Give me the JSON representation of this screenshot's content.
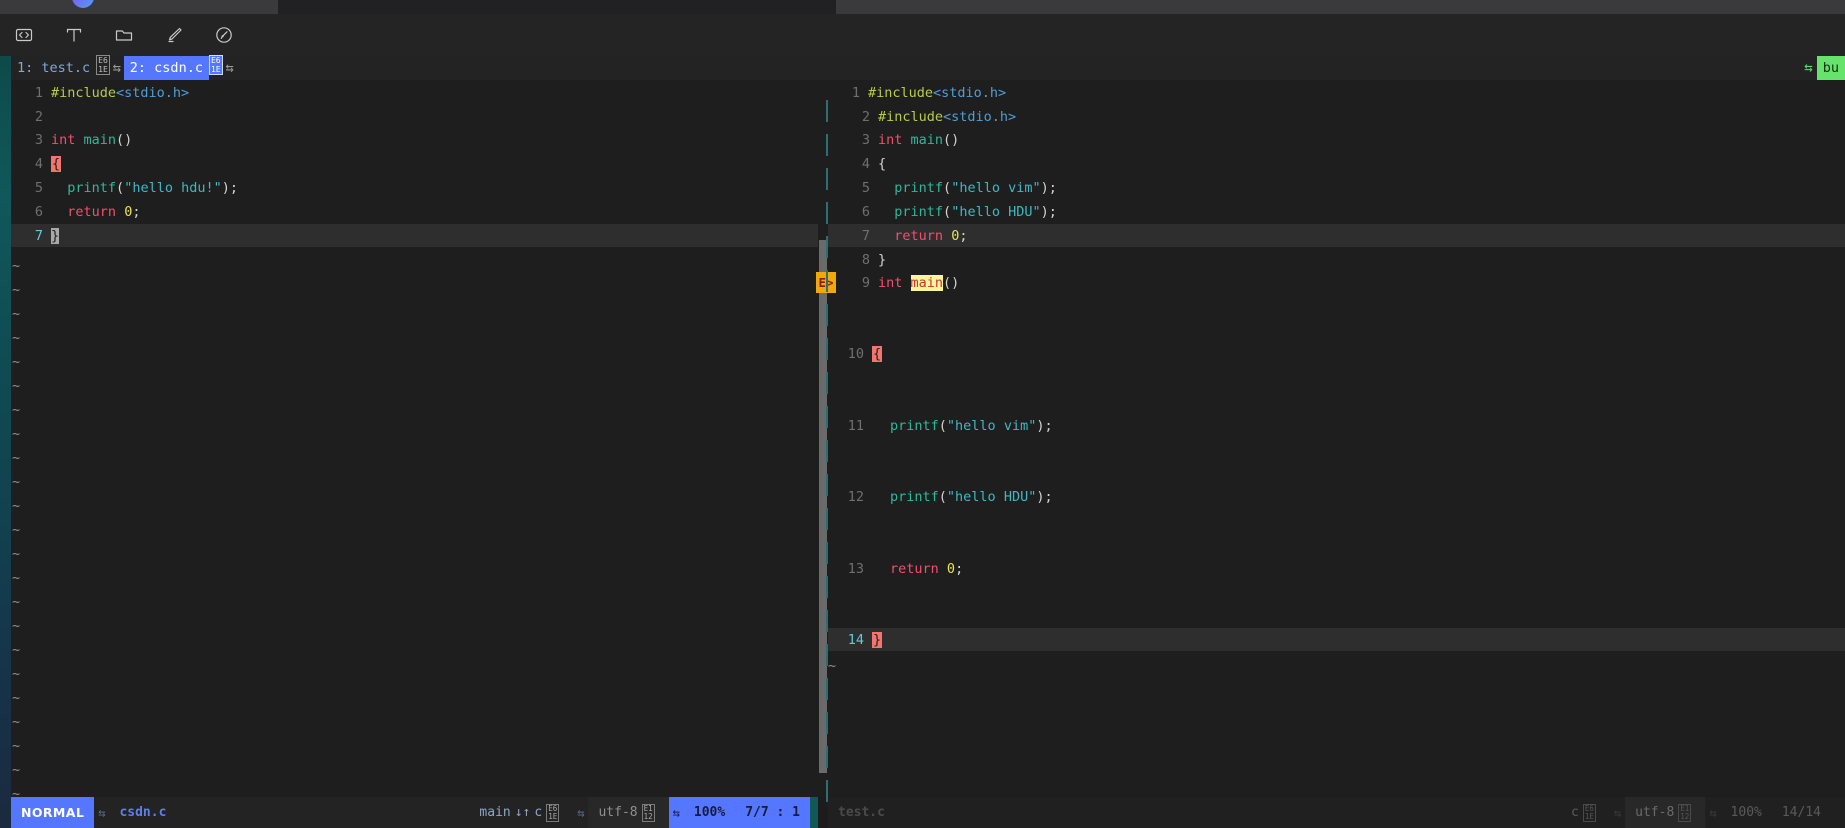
{
  "window": {
    "os_tabs": [
      "",
      "",
      ""
    ],
    "logo_icon": "app-logo"
  },
  "toolbar": {
    "icons": [
      {
        "name": "code-brackets-icon",
        "label": "<>"
      },
      {
        "name": "text-tool-icon",
        "label": "T"
      },
      {
        "name": "folder-icon",
        "label": "folder"
      },
      {
        "name": "pencil-edit-icon",
        "label": "edit"
      },
      {
        "name": "compass-dashboard-icon",
        "label": "compass"
      }
    ]
  },
  "tabline": {
    "tabs": [
      {
        "label": "1: test.c",
        "selected": false,
        "glyph_top": "E6",
        "glyph_bottom": "1E"
      },
      {
        "label": "2: csdn.c",
        "selected": true,
        "glyph_top": "E6",
        "glyph_bottom": "1E"
      }
    ],
    "separator": "⇆",
    "right_label": "bu",
    "right_arrow": "⇆"
  },
  "left_editor": {
    "filename": "test.c",
    "lines": [
      {
        "num": "1",
        "tokens": [
          {
            "t": "#include",
            "c": "s-pre"
          },
          {
            "t": "<stdio.h>",
            "c": "s-inc"
          }
        ]
      },
      {
        "num": "2",
        "tokens": []
      },
      {
        "num": "3",
        "tokens": [
          {
            "t": "int",
            "c": "s-kw"
          },
          {
            "t": " ",
            "c": "s-punc"
          },
          {
            "t": "main",
            "c": "s-fn"
          },
          {
            "t": "()",
            "c": "s-punc"
          }
        ]
      },
      {
        "num": "4",
        "tokens": [
          {
            "t": "{",
            "c": "err-brace"
          }
        ]
      },
      {
        "num": "5",
        "tokens": [
          {
            "t": "  ",
            "c": "s-punc"
          },
          {
            "t": "printf",
            "c": "s-fn"
          },
          {
            "t": "(",
            "c": "s-punc"
          },
          {
            "t": "\"hello hdu!\"",
            "c": "s-str"
          },
          {
            "t": ");",
            "c": "s-punc"
          }
        ]
      },
      {
        "num": "6",
        "tokens": [
          {
            "t": "  ",
            "c": "s-punc"
          },
          {
            "t": "return",
            "c": "s-kw"
          },
          {
            "t": " ",
            "c": "s-punc"
          },
          {
            "t": "0",
            "c": "s-num"
          },
          {
            "t": ";",
            "c": "s-punc"
          }
        ]
      },
      {
        "num": "7",
        "tokens": [
          {
            "t": "}",
            "c": "cursor"
          }
        ],
        "current": true
      }
    ],
    "tilde_count": 23,
    "tilde": "~"
  },
  "right_editor": {
    "filename": "test.c",
    "lines": [
      {
        "num": "1",
        "tokens": [
          {
            "t": "#include",
            "c": "s-pre"
          },
          {
            "t": "<stdio.h>",
            "c": "s-inc"
          }
        ]
      },
      {
        "num": "2",
        "tokens": [
          {
            "t": "#include",
            "c": "s-pre"
          },
          {
            "t": "<stdio.h>",
            "c": "s-inc"
          }
        ]
      },
      {
        "num": "3",
        "tokens": [
          {
            "t": "int",
            "c": "s-kw"
          },
          {
            "t": " ",
            "c": "s-punc"
          },
          {
            "t": "main",
            "c": "s-fn"
          },
          {
            "t": "()",
            "c": "s-punc"
          }
        ]
      },
      {
        "num": "4",
        "tokens": [
          {
            "t": "{",
            "c": "s-brace"
          }
        ]
      },
      {
        "num": "5",
        "tokens": [
          {
            "t": "  ",
            "c": "s-punc"
          },
          {
            "t": "printf",
            "c": "s-fn"
          },
          {
            "t": "(",
            "c": "s-punc"
          },
          {
            "t": "\"hello vim\"",
            "c": "s-str"
          },
          {
            "t": ");",
            "c": "s-punc"
          }
        ]
      },
      {
        "num": "6",
        "tokens": [
          {
            "t": "  ",
            "c": "s-punc"
          },
          {
            "t": "printf",
            "c": "s-fn"
          },
          {
            "t": "(",
            "c": "s-punc"
          },
          {
            "t": "\"hello HDU\"",
            "c": "s-str"
          },
          {
            "t": ");",
            "c": "s-punc"
          }
        ]
      },
      {
        "num": "7",
        "tokens": [
          {
            "t": "  ",
            "c": "s-punc"
          },
          {
            "t": "return",
            "c": "s-kw"
          },
          {
            "t": " ",
            "c": "s-punc"
          },
          {
            "t": "0",
            "c": "s-num"
          },
          {
            "t": ";",
            "c": "s-punc"
          }
        ],
        "current": true
      },
      {
        "num": "8",
        "tokens": [
          {
            "t": "}",
            "c": "s-brace"
          }
        ]
      },
      {
        "num": "9",
        "tokens": [
          {
            "t": "int",
            "c": "s-kw"
          },
          {
            "t": " ",
            "c": "s-punc"
          },
          {
            "t": "main",
            "c": "hl-search"
          },
          {
            "t": "()",
            "c": "s-punc"
          }
        ],
        "error": "E>"
      },
      {
        "num": "10",
        "tokens": [
          {
            "t": "{",
            "c": "err-brace"
          }
        ]
      },
      {
        "num": "11",
        "tokens": [
          {
            "t": "  ",
            "c": "s-punc"
          },
          {
            "t": "printf",
            "c": "s-fn"
          },
          {
            "t": "(",
            "c": "s-punc"
          },
          {
            "t": "\"hello vim\"",
            "c": "s-str"
          },
          {
            "t": ");",
            "c": "s-punc"
          }
        ]
      },
      {
        "num": "12",
        "tokens": [
          {
            "t": "  ",
            "c": "s-punc"
          },
          {
            "t": "printf",
            "c": "s-fn"
          },
          {
            "t": "(",
            "c": "s-punc"
          },
          {
            "t": "\"hello HDU\"",
            "c": "s-str"
          },
          {
            "t": ");",
            "c": "s-punc"
          }
        ]
      },
      {
        "num": "13",
        "tokens": [
          {
            "t": "  ",
            "c": "s-punc"
          },
          {
            "t": "return",
            "c": "s-kw"
          },
          {
            "t": " ",
            "c": "s-punc"
          },
          {
            "t": "0",
            "c": "s-num"
          },
          {
            "t": ";",
            "c": "s-punc"
          }
        ]
      },
      {
        "num": "14",
        "tokens": [
          {
            "t": "}",
            "c": "err-brace"
          }
        ],
        "current": true,
        "cur_num": true
      }
    ],
    "tilde": "~",
    "error_marker": "E>"
  },
  "status_left": {
    "mode": "NORMAL",
    "sep": "⇆",
    "filename": "csdn.c",
    "branch": "main",
    "branch_icon": "↓↑",
    "filetype": "c",
    "glyph1_top": "E6",
    "glyph1_bottom": "1E",
    "encoding": "utf-8",
    "glyph2_top": "E1",
    "glyph2_bottom": "12",
    "percent": "100%",
    "position": "7/7 :  1"
  },
  "status_right": {
    "filename": "test.c",
    "filetype": "c",
    "glyph1_top": "E6",
    "glyph1_bottom": "1E",
    "encoding": "utf-8",
    "glyph2_top": "E1",
    "glyph2_bottom": "12",
    "percent": "100%",
    "position": "14/14"
  },
  "colors": {
    "accent_blue": "#5577ff",
    "error_red": "#f4746e",
    "error_marker": "#f0a80c",
    "search_highlight": "#fbf5a0",
    "green_tab": "#66e36a",
    "background": "#1e1e1e"
  }
}
